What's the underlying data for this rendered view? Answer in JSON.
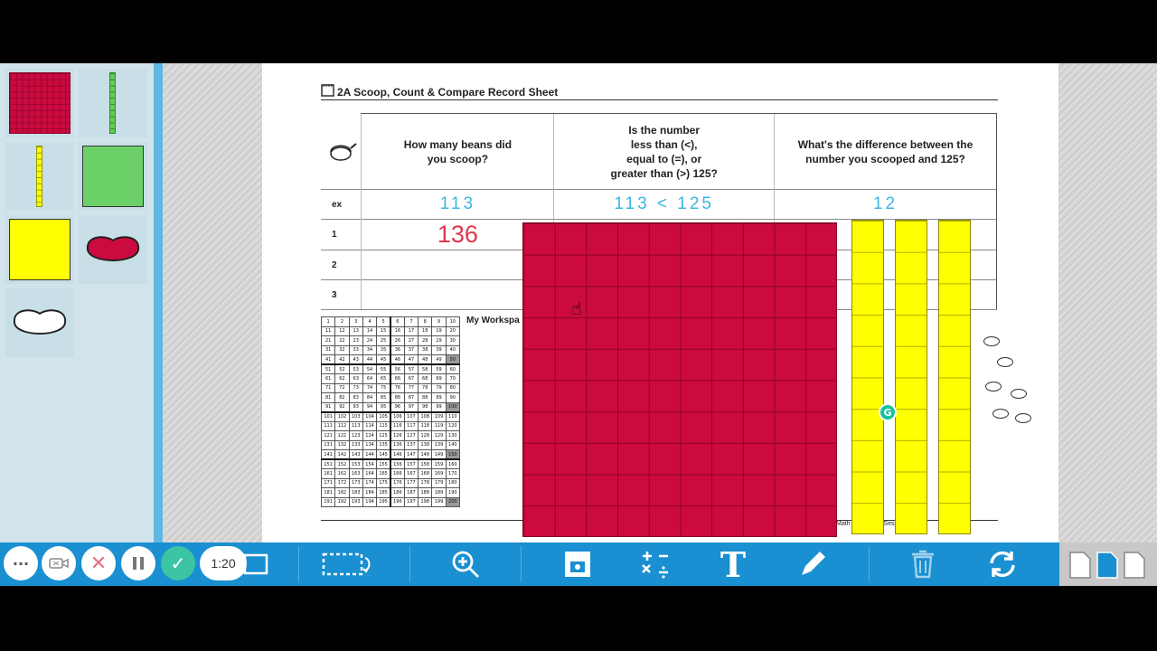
{
  "sheet": {
    "title": "2A Scoop, Count & Compare Record Sheet",
    "headers": {
      "col1": "How many beans did you scoop?",
      "col2_l1": "Is the number",
      "col2_l2": "less than (<),",
      "col2_l3": "equal to (=), or",
      "col2_l4": "greater than (>) 125?",
      "col3": "What's the difference between the number you scooped and 125?"
    },
    "rows": [
      {
        "label": "ex",
        "scooped": "113",
        "compare": "113 < 125",
        "difference": "12"
      },
      {
        "label": "1",
        "scooped": "136",
        "compare": "",
        "difference": ""
      },
      {
        "label": "2",
        "scooped": "",
        "compare": "",
        "difference": ""
      },
      {
        "label": "3",
        "scooped": "",
        "compare": "",
        "difference": ""
      }
    ],
    "workspace_label": "My Workspa",
    "footer": "Math Grade 2 M Session 2",
    "hundreds_chart": {
      "start": 1,
      "end": 200,
      "columns": 10,
      "highlighted": [
        50,
        100,
        150,
        200
      ]
    }
  },
  "palette": {
    "items": [
      "hundreds-flat",
      "tens-rod-green",
      "tens-rod-yellow",
      "green-square",
      "yellow-square",
      "red-bean",
      "white-bean"
    ]
  },
  "colors": {
    "flat": "#cc0a3f",
    "rod": "#ffff00",
    "toolbar": "#1a8fd1",
    "blue_ink": "#3bb7e4",
    "red_ink": "#e0374f"
  },
  "recorder": {
    "time": "1:20"
  },
  "toolbar": {
    "tools": [
      "screen-icon",
      "frame-icon",
      "zoom-icon",
      "stamp-icon",
      "math-ops-icon",
      "text-icon",
      "pen-icon",
      "trash-icon",
      "refresh-icon"
    ],
    "text_tool_glyph": "T",
    "math_glyph": "+−×÷"
  }
}
